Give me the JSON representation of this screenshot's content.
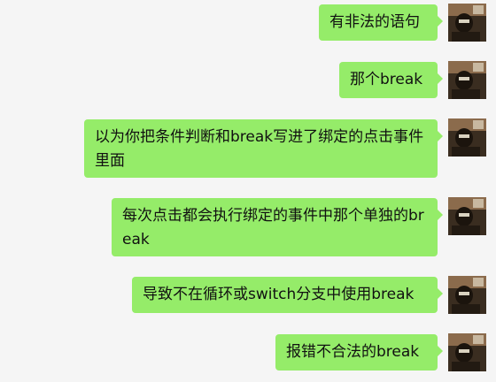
{
  "window": {
    "title": ""
  },
  "messages": [
    {
      "sender": "self",
      "text": "有非法的语句"
    },
    {
      "sender": "self",
      "text": "那个break"
    },
    {
      "sender": "self",
      "text": "以为你把条件判断和break写进了绑定的点击事件里面"
    },
    {
      "sender": "self",
      "text": "每次点击都会执行绑定的事件中那个单独的break"
    },
    {
      "sender": "self",
      "text": "导致不在循环或switch分支中使用break"
    },
    {
      "sender": "self",
      "text": "报错不合法的break"
    }
  ],
  "colors": {
    "background": "#f5f5f5",
    "bubble": "#95ec69",
    "text": "#111111"
  },
  "icons": {
    "avatar": "user-avatar-icon"
  }
}
